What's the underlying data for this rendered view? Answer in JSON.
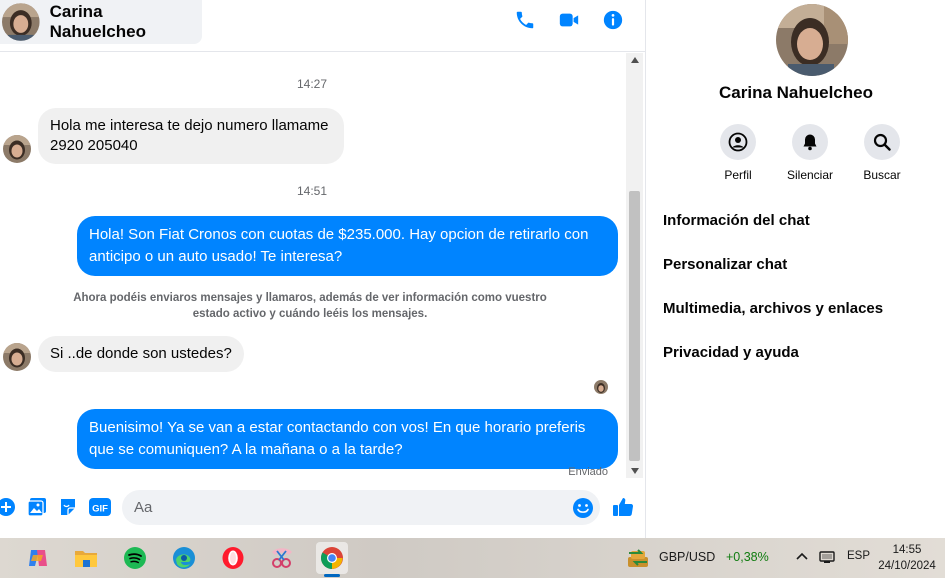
{
  "header": {
    "contact_name": "Carina Nahuelcheo",
    "icons": [
      "phone-icon",
      "video-camera-icon",
      "info-icon"
    ]
  },
  "conversation": {
    "time_1": "14:27",
    "msg_1": "Hola me interesa te dejo numero llamame 2920 205040",
    "time_2": "14:51",
    "msg_2": "Hola! Son Fiat Cronos con cuotas de $235.000. Hay opcion de retirarlo con anticipo o un auto usado! Te interesa?",
    "notice": "Ahora podéis enviaros mensajes y llamaros, además de ver información como vuestro estado activo y cuándo leéis los mensajes.",
    "msg_3": "Si ..de donde son ustedes?",
    "msg_4": "Buenisimo! Ya se van a estar contactando con vos! En que horario preferis que se comuniquen? A la mañana o a la tarde?",
    "status": "Enviado"
  },
  "composer": {
    "placeholder": "Aa",
    "icons": [
      "plus-circle-icon",
      "image-icon",
      "sticker-icon",
      "gif-icon",
      "emoji-icon",
      "thumbs-up-icon"
    ],
    "gif_label": "GIF"
  },
  "info_panel": {
    "name": "Carina Nahuelcheo",
    "actions": [
      {
        "label": "Perfil",
        "icon": "profile-icon"
      },
      {
        "label": "Silenciar",
        "icon": "bell-icon"
      },
      {
        "label": "Buscar",
        "icon": "search-icon"
      }
    ],
    "menu": [
      "Información del chat",
      "Personalizar chat",
      "Multimedia, archivos y enlaces",
      "Privacidad y ayuda"
    ]
  },
  "taskbar": {
    "apps": [
      "copilot-icon",
      "file-explorer-icon",
      "spotify-icon",
      "edge-icon",
      "opera-icon",
      "snipping-tool-icon",
      "chrome-icon"
    ],
    "ticker_label": "GBP/USD",
    "ticker_change": "+0,38%",
    "language": "ESP",
    "time": "14:55",
    "date": "24/10/2024"
  },
  "colors": {
    "accent": "#0084ff",
    "bubble_in": "#f0f0f0",
    "ticker_up": "#107c10"
  }
}
